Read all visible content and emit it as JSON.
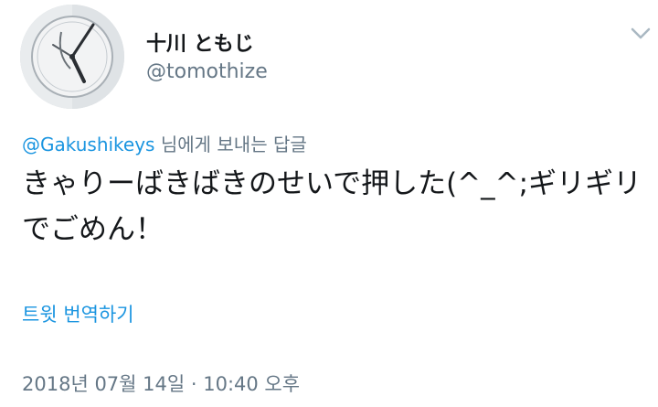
{
  "user": {
    "display_name": "十川 ともじ",
    "handle": "@tomothize",
    "avatar": "avatar-clock-photo"
  },
  "reply": {
    "mention": "@Gakushikeys",
    "suffix": " 님에게 보내는 답글"
  },
  "tweet": {
    "text": "きゃりーばきばきのせいで押した(^_^;ギリギリでごめん！"
  },
  "actions": {
    "translate_label": "트윗 번역하기"
  },
  "meta": {
    "timestamp": "2018년 07월 14일 · 10:40 오후"
  },
  "colors": {
    "link": "#1b95e0",
    "secondary": "#657786",
    "primary": "#14171a"
  },
  "icons": {
    "menu": "chevron-down-icon"
  }
}
